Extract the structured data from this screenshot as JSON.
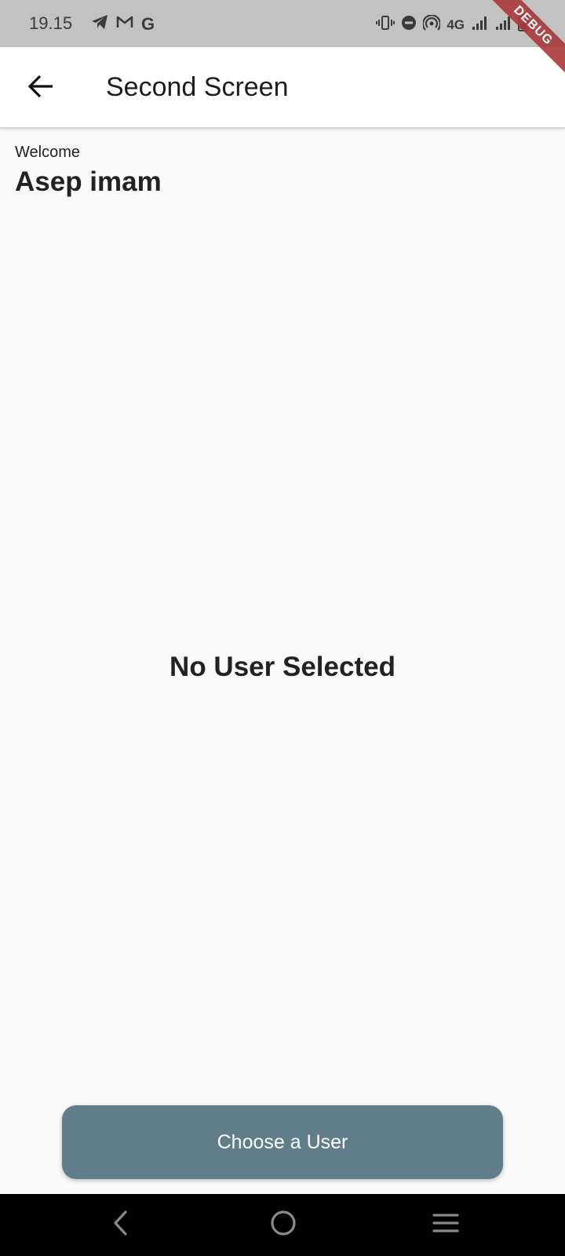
{
  "status_bar": {
    "time": "19.15",
    "network": "4G",
    "google_letter": "G",
    "left_icons": [
      "telegram-icon",
      "gmail-icon",
      "google-icon"
    ],
    "right_icons": [
      "vibrate-icon",
      "do-not-disturb-icon",
      "hotspot-icon",
      "signal-icon",
      "signal-icon",
      "battery-icon"
    ]
  },
  "debug_banner": "DEBUG",
  "app_bar": {
    "title": "Second Screen",
    "back_icon": "arrow-back-icon"
  },
  "welcome": {
    "label": "Welcome",
    "name": "Asep imam"
  },
  "selected_user_text": "No User Selected",
  "choose_button_label": "Choose a User",
  "nav_bar": {
    "icons": [
      "back-icon",
      "home-icon",
      "menu-icon"
    ]
  },
  "colors": {
    "status_bar": "#c2c2c2",
    "background": "#fafafa",
    "app_bar": "#ffffff",
    "button": "#627d8a",
    "debug_banner": "#a93a3a",
    "nav_bar": "#000000"
  }
}
